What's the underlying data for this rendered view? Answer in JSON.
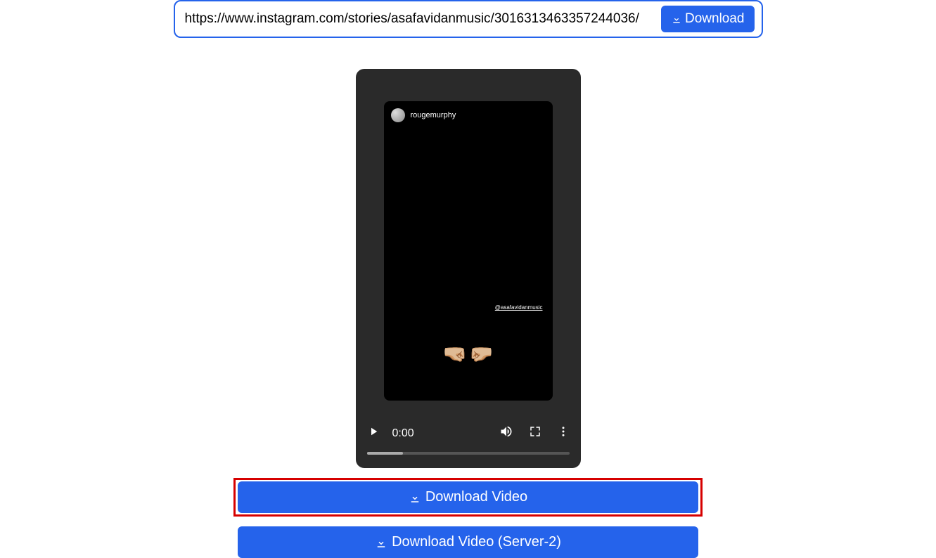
{
  "url_bar": {
    "value": "https://www.instagram.com/stories/asafavidanmusic/3016313463357244036/",
    "download_label": "Download"
  },
  "story": {
    "username": "rougemurphy",
    "mention": "@asafavidanmusic"
  },
  "player": {
    "time": "0:00"
  },
  "buttons": {
    "download_video": "Download Video",
    "download_video_server2": "Download Video (Server-2)"
  }
}
